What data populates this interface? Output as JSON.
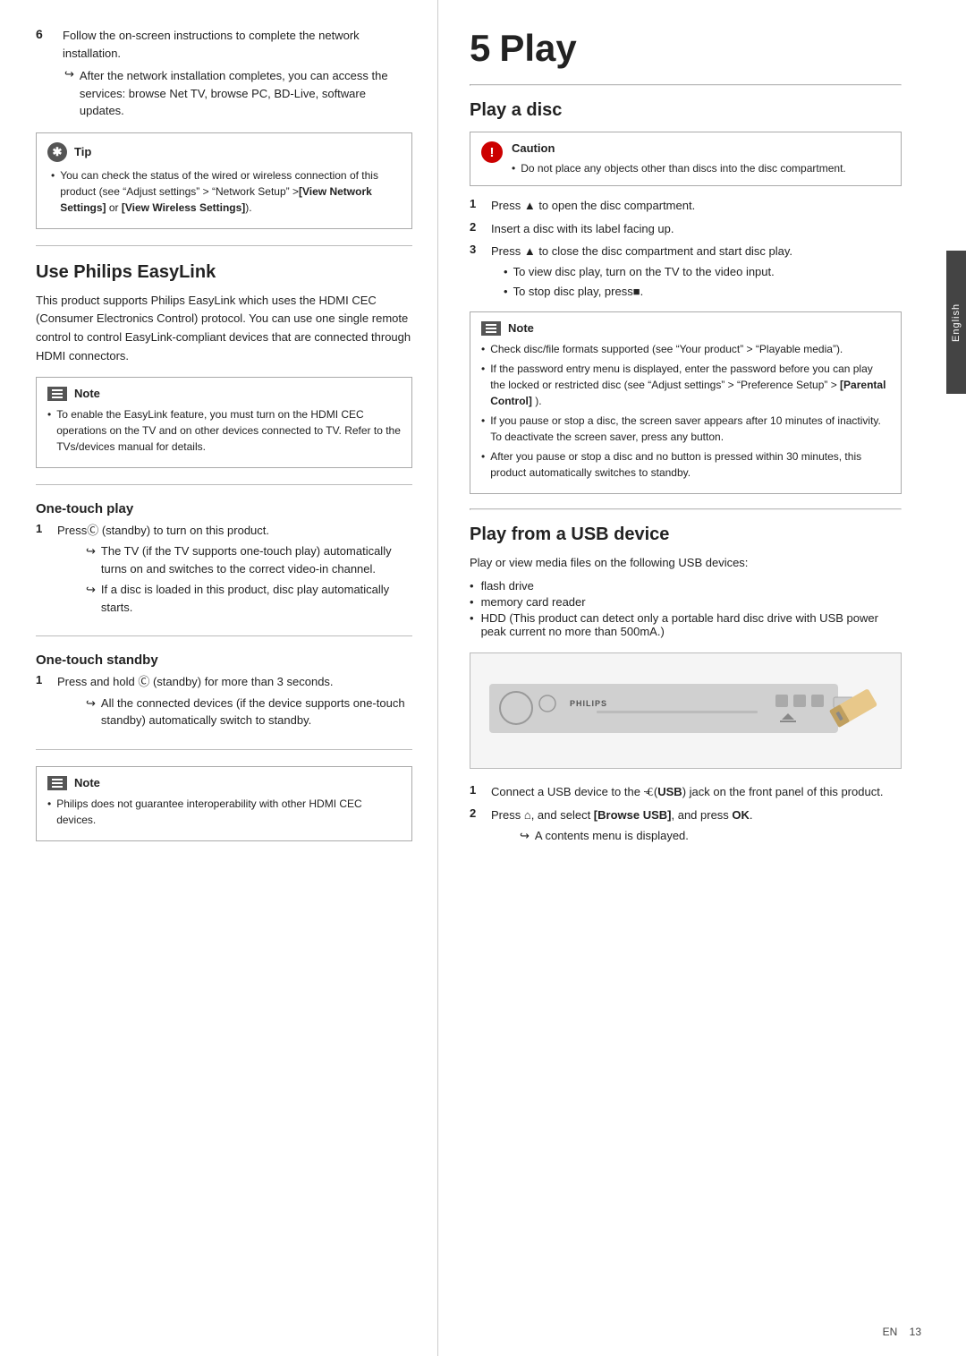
{
  "left": {
    "step6": {
      "number": "6",
      "text": "Follow the on-screen instructions to complete the network installation.",
      "arrow1": "After the network installation completes, you can access the services: browse Net TV, browse PC, BD-Live, software updates."
    },
    "tip": {
      "label": "Tip",
      "bullets": [
        "You can check the status of the wired or wireless connection of this product (see “Adjust settings” > “Network Setup” >[View Network Settings] or [View Wireless Settings])."
      ]
    },
    "easylink": {
      "title": "Use Philips EasyLink",
      "body": "This product supports Philips EasyLink which uses the HDMI CEC (Consumer Electronics Control) protocol. You can use one single remote control to control EasyLink-compliant devices that are connected through HDMI connectors.",
      "note": {
        "label": "Note",
        "bullets": [
          "To enable the EasyLink feature, you must turn on the HDMI CEC operations on the TV and on other devices connected to TV. Refer to the TVs/devices manual for details."
        ]
      }
    },
    "onetouch_play": {
      "subtitle": "One-touch play",
      "step1": {
        "num": "1",
        "text": "Pressⓘ (standby) to turn on this product.",
        "arrows": [
          "The TV (if the TV supports one-touch play) automatically turns on and switches to the correct video-in channel.",
          "If a disc is loaded in this product, disc play automatically starts."
        ]
      }
    },
    "onetouch_standby": {
      "subtitle": "One-touch standby",
      "step1": {
        "num": "1",
        "text": "Press and hold ⓘ (standby) for more than 3 seconds.",
        "arrows": [
          "All the connected devices (if the device supports one-touch standby) automatically switch to standby."
        ]
      }
    },
    "note2": {
      "label": "Note",
      "bullets": [
        "Philips does not guarantee interoperability with other HDMI CEC devices."
      ]
    }
  },
  "right": {
    "chapter": {
      "number": "5",
      "title": "Play"
    },
    "play_disc": {
      "title": "Play a disc",
      "caution": {
        "label": "Caution",
        "bullets": [
          "Do not place any objects other than discs into the disc compartment."
        ]
      },
      "steps": [
        {
          "num": "1",
          "text": "Press ▲ to open the disc compartment."
        },
        {
          "num": "2",
          "text": "Insert a disc with its label facing up."
        },
        {
          "num": "3",
          "text": "Press ▲ to close the disc compartment and start disc play.",
          "bullets": [
            "To view disc play, turn on the TV to the video input.",
            "To stop disc play, press■."
          ]
        }
      ],
      "note": {
        "label": "Note",
        "bullets": [
          "Check disc/file formats supported (see “Your product” > “Playable media”).",
          "If the password entry menu is displayed, enter the password before you can play the locked or restricted disc (see “Adjust settings” > “Preference Setup” > [Parental Control] ).",
          "If you pause or stop a disc, the screen saver appears after 10 minutes of inactivity. To deactivate the screen saver, press any button.",
          "After you pause or stop a disc and no button is pressed within 30 minutes, this product automatically switches to standby."
        ]
      }
    },
    "play_usb": {
      "title": "Play from a USB device",
      "intro": "Play or view media files on the following USB devices:",
      "bullets": [
        "flash drive",
        "memory card reader",
        "HDD (This product can detect only a portable hard disc drive with USB power peak current no more than 500mA.)"
      ],
      "steps": [
        {
          "num": "1",
          "text": "Connect a USB device to the ⭅(USB) jack on the front panel of this product."
        },
        {
          "num": "2",
          "text": "Press ⌂, and select [Browse USB], and press OK.",
          "arrows": [
            "A contents menu is displayed."
          ]
        }
      ]
    }
  },
  "footer": {
    "lang": "English",
    "page_label": "EN",
    "page_num": "13"
  }
}
